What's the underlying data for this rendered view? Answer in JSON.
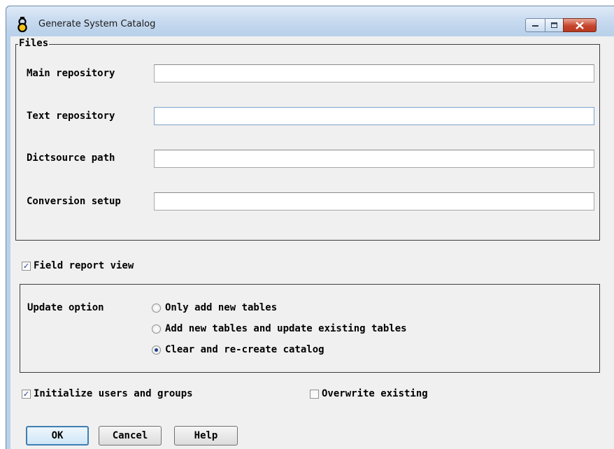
{
  "window": {
    "title": "Generate System Catalog"
  },
  "titlebar": {
    "minimize_icon": "minimize-icon",
    "maximize_icon": "maximize-icon",
    "close_icon": "close-icon"
  },
  "files": {
    "legend": "Files",
    "fields": [
      {
        "label": "Main repository",
        "value": ""
      },
      {
        "label": "Text repository",
        "value": ""
      },
      {
        "label": "Dictsource path",
        "value": ""
      },
      {
        "label": "Conversion setup",
        "value": ""
      }
    ]
  },
  "field_report_view": {
    "label": "Field report view",
    "checked": true
  },
  "update_option": {
    "label": "Update option",
    "options": [
      {
        "label": "Only add new tables",
        "selected": false
      },
      {
        "label": "Add new tables and update existing tables",
        "selected": false
      },
      {
        "label": "Clear and re-create catalog",
        "selected": true
      }
    ]
  },
  "initialize_users": {
    "label": "Initialize users and groups",
    "checked": true
  },
  "overwrite_existing": {
    "label": "Overwrite existing",
    "checked": false
  },
  "buttons": {
    "ok": "OK",
    "cancel": "Cancel",
    "help": "Help"
  }
}
